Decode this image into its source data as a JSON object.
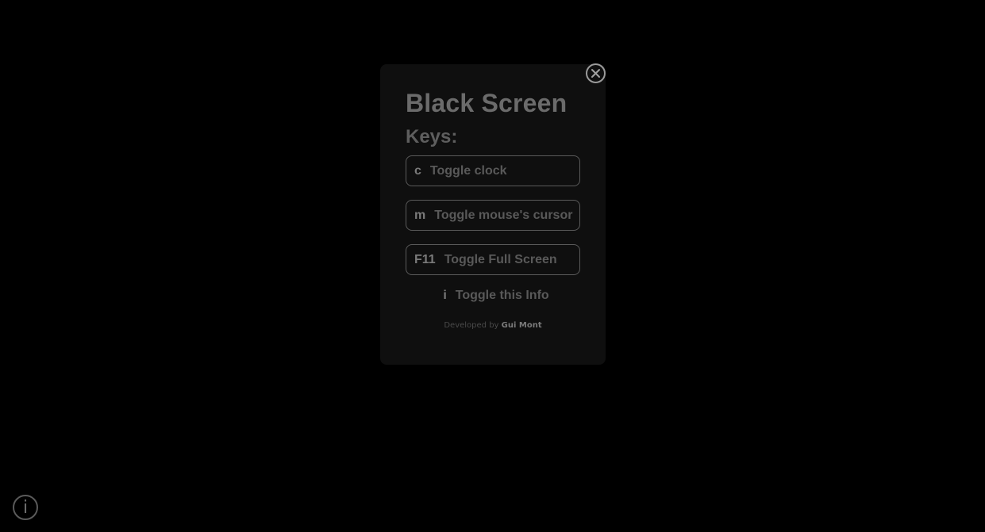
{
  "modal": {
    "title": "Black Screen",
    "keys_heading": "Keys:",
    "shortcuts": [
      {
        "key": "c",
        "label": "Toggle clock"
      },
      {
        "key": "m",
        "label": "Toggle mouse's cursor"
      },
      {
        "key": "F11",
        "label": "Toggle Full Screen"
      },
      {
        "key": "i",
        "label": "Toggle this Info"
      }
    ],
    "credit_prefix": "Developed by",
    "credit_author": "Gui Mont"
  },
  "icons": {
    "close": "close-circle-icon",
    "info": "info-icon"
  },
  "info_button_glyph": "i",
  "colors": {
    "background": "#000000",
    "panel": "#0f0f0f",
    "text": "#6b6b6b",
    "border": "#5a5a5a"
  }
}
